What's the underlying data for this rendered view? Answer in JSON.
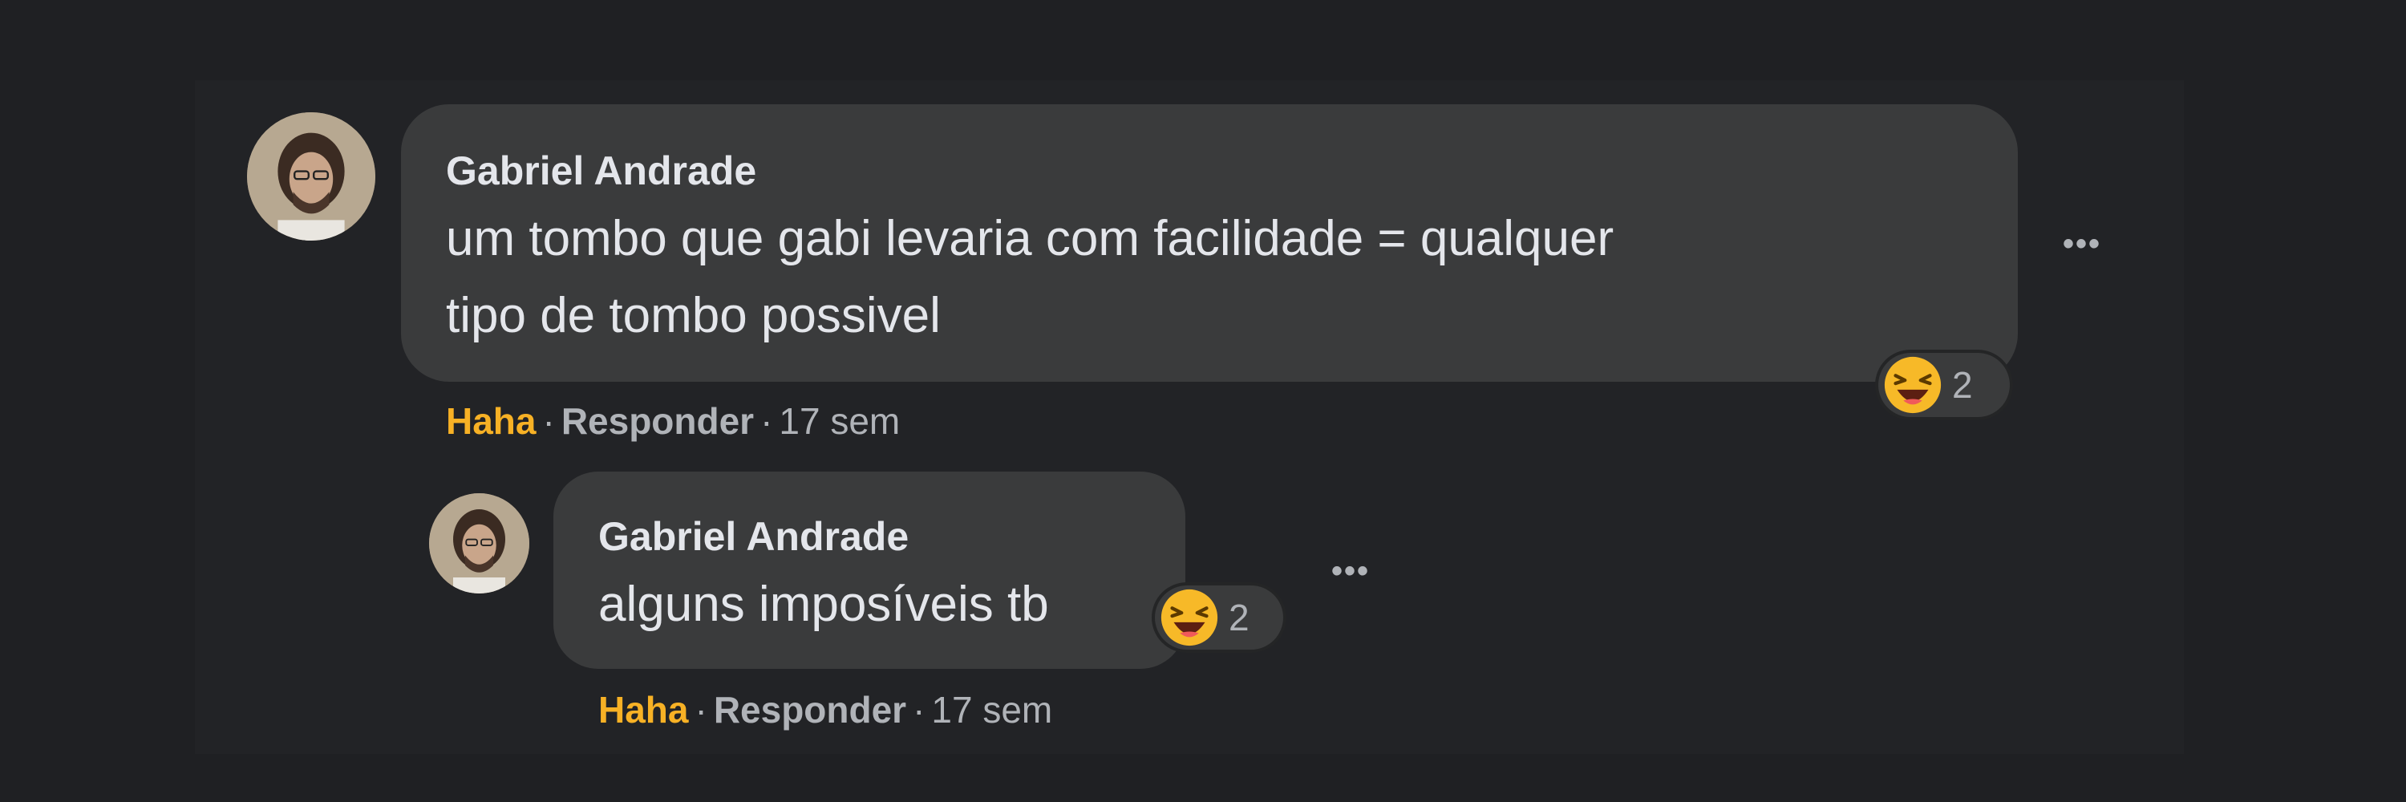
{
  "comment": {
    "author": "Gabriel Andrade",
    "text_line1": "um tombo que gabi levaria com facilidade = qualquer",
    "text_line2": "tipo de tombo possivel",
    "reaction_icon": "laughing-face-icon",
    "reaction_count": "2",
    "more_label": "•••",
    "actions": {
      "react": "Haha",
      "sep1": "·",
      "reply": "Responder",
      "sep2": "·",
      "time": "17 sem"
    }
  },
  "reply": {
    "author": "Gabriel Andrade",
    "text": "alguns imposíveis tb",
    "reaction_icon": "laughing-face-icon",
    "reaction_count": "2",
    "more_label": "•••",
    "actions": {
      "react": "Haha",
      "sep1": "·",
      "reply": "Responder",
      "sep2": "·",
      "time": "17 sem"
    }
  },
  "colors": {
    "background": "#1f2023",
    "bubble": "#3a3b3c",
    "text": "#e4e6eb",
    "muted": "#b0b3b8",
    "haha": "#f7b125"
  }
}
